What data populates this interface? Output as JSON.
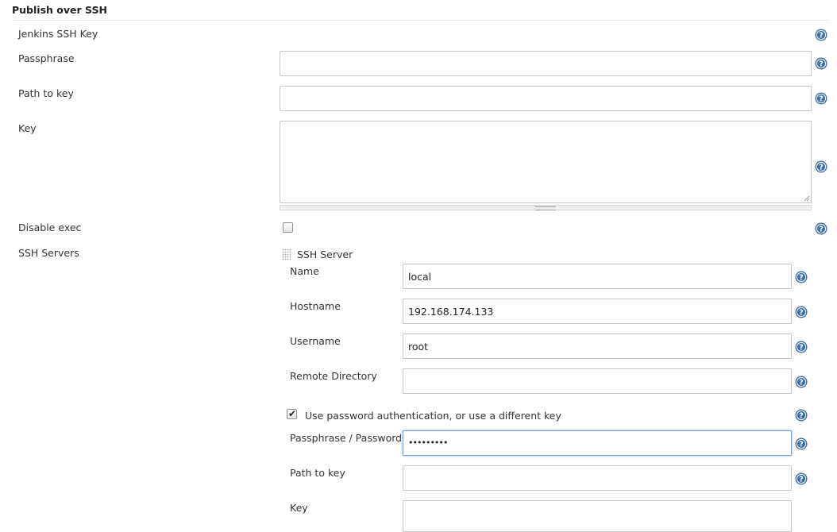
{
  "section": {
    "title": "Publish over SSH"
  },
  "fields": {
    "jenkins_ssh_key": {
      "label": "Jenkins SSH Key"
    },
    "passphrase": {
      "label": "Passphrase",
      "value": ""
    },
    "path_to_key": {
      "label": "Path to key",
      "value": ""
    },
    "key": {
      "label": "Key",
      "value": ""
    },
    "disable_exec": {
      "label": "Disable exec",
      "checked": false
    },
    "ssh_servers": {
      "label": "SSH Servers"
    }
  },
  "ssh_server": {
    "title": "SSH Server",
    "name": {
      "label": "Name",
      "value": "local"
    },
    "hostname": {
      "label": "Hostname",
      "value": "192.168.174.133"
    },
    "username": {
      "label": "Username",
      "value": "root"
    },
    "remote_directory": {
      "label": "Remote Directory",
      "value": ""
    },
    "use_password_auth": {
      "label": "Use password authentication, or use a different key",
      "checked": true
    },
    "passphrase_password": {
      "label": "Passphrase / Password",
      "value": "•••••••••"
    },
    "path_to_key": {
      "label": "Path to key",
      "value": ""
    },
    "key": {
      "label": "Key",
      "value": ""
    }
  },
  "colors": {
    "help_icon": "#3d6ea8",
    "focus_border": "#78a3d6"
  },
  "icons": {
    "help": "help-icon",
    "drag": "drag-handle-icon"
  }
}
